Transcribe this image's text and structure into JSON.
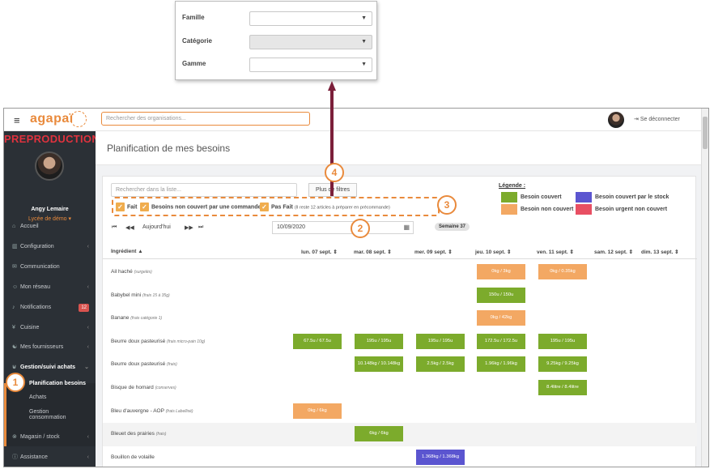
{
  "filter_panel": {
    "famille_label": "Famille",
    "categorie_label": "Catégorie",
    "gamme_label": "Gamme"
  },
  "topbar": {
    "logo": "agapaï",
    "search_placeholder": "Rechercher des organisations...",
    "logout": "Se déconnecter"
  },
  "sidebar": {
    "banner": "PREPRODUCTION",
    "user_name": "Angy Lemaire",
    "school": "Lycée de démo ▾",
    "items": [
      {
        "label": "Accueil",
        "icon": "home-icon"
      },
      {
        "label": "Configuration",
        "icon": "bank-icon"
      },
      {
        "label": "Communication",
        "icon": "chat-icon"
      },
      {
        "label": "Mon réseau",
        "icon": "users-icon"
      },
      {
        "label": "Notifications",
        "icon": "bell-icon",
        "badge": "12"
      },
      {
        "label": "Cuisine",
        "icon": "cutlery-icon"
      },
      {
        "label": "Mes fournisseurs",
        "icon": "handshake-icon"
      },
      {
        "label": "Gestion/suivi achats",
        "icon": "cart-icon"
      },
      {
        "label": "Magasin / stock",
        "icon": "boxes-icon"
      },
      {
        "label": "Assistance",
        "icon": "info-icon"
      }
    ],
    "sub_items": [
      {
        "label": "Planification besoins"
      },
      {
        "label": "Achats"
      },
      {
        "label": "Gestion consommation"
      }
    ]
  },
  "main": {
    "title": "Planification de mes besoins",
    "list_search_placeholder": "Rechercher dans la liste...",
    "more_filters": "Plus de filtres",
    "checks": {
      "fait": "Fait",
      "non_couvert": "Besoins non couvert par une commande",
      "pas_fait": "Pas Fait",
      "pas_fait_note": "(Il reste 12 articles à préparer en précommande)"
    },
    "nav": {
      "first": "⏮",
      "prev": "◀◀",
      "today": "Aujourd'hui",
      "next": "▶▶",
      "last": "⏭"
    },
    "date": "10/09/2020",
    "week": "Semaine 37",
    "legend": {
      "title": "Légende :",
      "couvert": "Besoin couvert",
      "non_couvert": "Besoin non couvert",
      "stock": "Besoin couvert par le stock",
      "urgent": "Besoin urgent non couvert"
    },
    "colors": {
      "green": "#7cab2c",
      "orange": "#f3a863",
      "blue": "#5b55d0",
      "red": "#e84f63",
      "accent": "#e98a3c"
    }
  },
  "callouts": [
    "1",
    "2",
    "3",
    "4"
  ],
  "table": {
    "headers": [
      "Ingrédient ▲",
      "lun. 07 sept. ⇕",
      "mar. 08 sept. ⇕",
      "mer. 09 sept. ⇕",
      "jeu. 10 sept. ⇕",
      "ven. 11 sept. ⇕",
      "sam. 12 sept. ⇕",
      "dim. 13 sept. ⇕"
    ],
    "rows": [
      {
        "name": "Ail haché",
        "note": "(surgelés)",
        "cells": [
          null,
          null,
          null,
          {
            "v": "0kg / 3kg",
            "c": "orange"
          },
          {
            "v": "0kg / 0.35kg",
            "c": "orange"
          },
          null,
          null
        ]
      },
      {
        "name": "Babybel mini",
        "note": "(frais 15 à 35g)",
        "cells": [
          null,
          null,
          null,
          {
            "v": "150u / 150u",
            "c": "green"
          },
          null,
          null,
          null
        ]
      },
      {
        "name": "Banane",
        "note": "(frais catégorie 1)",
        "cells": [
          null,
          null,
          null,
          {
            "v": "0kg / 42kg",
            "c": "orange"
          },
          null,
          null,
          null
        ]
      },
      {
        "name": "Beurre doux pasteurisé",
        "note": "(frais micro-pain 10g)",
        "cells": [
          {
            "v": "67.5u / 67.5u",
            "c": "green"
          },
          {
            "v": "195u / 195u",
            "c": "green"
          },
          {
            "v": "195u / 195u",
            "c": "green"
          },
          {
            "v": "172.5u / 172.5u",
            "c": "green"
          },
          {
            "v": "195u / 195u",
            "c": "green"
          },
          null,
          null
        ]
      },
      {
        "name": "Beurre doux pasteurisé",
        "note": "(frais)",
        "cells": [
          null,
          {
            "v": "10.148kg / 10.148kg",
            "c": "green"
          },
          {
            "v": "2.5kg / 2.5kg",
            "c": "green"
          },
          {
            "v": "1.96kg / 1.96kg",
            "c": "green"
          },
          {
            "v": "9.25kg / 9.25kg",
            "c": "green"
          },
          null,
          null
        ]
      },
      {
        "name": "Bisque de homard",
        "note": "(conserves)",
        "cells": [
          null,
          null,
          null,
          null,
          {
            "v": "8.4litre / 8.4litre",
            "c": "green"
          },
          null,
          null
        ]
      },
      {
        "name": "Bleu d'auvergne - AOP",
        "note": "(frais Labellisé)",
        "cells": [
          {
            "v": "0kg / 6kg",
            "c": "orange"
          },
          null,
          null,
          null,
          null,
          null,
          null
        ]
      },
      {
        "name": "Bleuet des prairies",
        "note": "(frais)",
        "cells": [
          null,
          {
            "v": "6kg / 6kg",
            "c": "green"
          },
          null,
          null,
          null,
          null,
          null
        ]
      },
      {
        "name": "Bouillon de volaille",
        "note": "",
        "cells": [
          null,
          null,
          {
            "v": "1.368kg / 1.368kg",
            "c": "blue"
          },
          null,
          null,
          null,
          null
        ]
      }
    ]
  }
}
